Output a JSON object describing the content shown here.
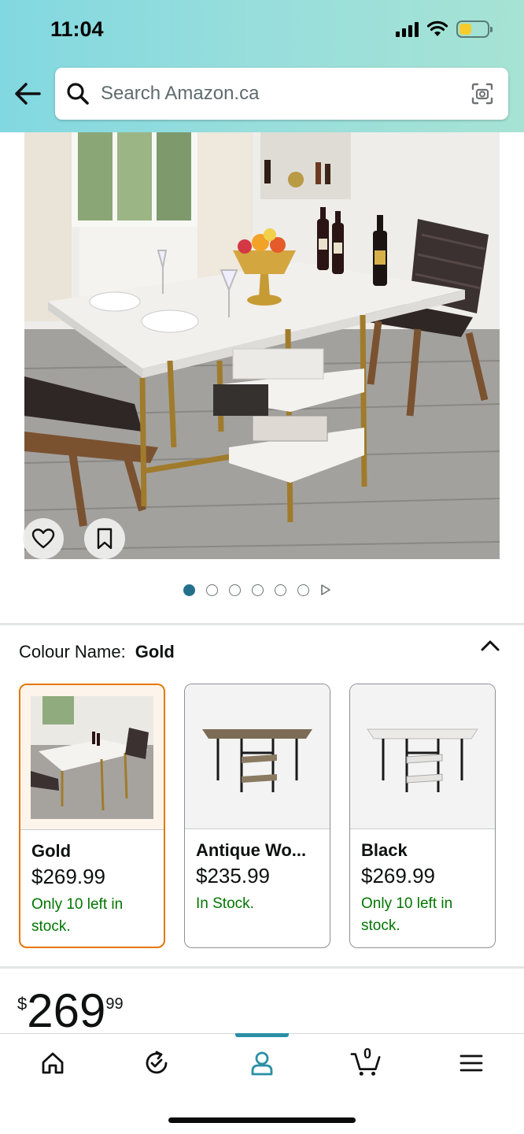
{
  "status_bar": {
    "time": "11:04"
  },
  "search": {
    "placeholder": "Search Amazon.ca"
  },
  "carousel": {
    "total_dots": 6,
    "active_index": 0
  },
  "colour": {
    "label": "Colour Name:",
    "value": "Gold"
  },
  "swatches": [
    {
      "name": "Gold",
      "price": "$269.99",
      "stock": "Only 10 left in stock.",
      "selected": true
    },
    {
      "name": "Antique Wo...",
      "price": "$235.99",
      "stock": "In Stock.",
      "selected": false
    },
    {
      "name": "Black",
      "price": "$269.99",
      "stock": "Only 10 left in stock.",
      "selected": false
    }
  ],
  "price": {
    "symbol": "$",
    "whole": "269",
    "fraction": "99"
  },
  "cart": {
    "count": "0"
  },
  "colors": {
    "accent": "#23708c",
    "selected_border": "#e77600",
    "stock_green": "#007600"
  },
  "icons": [
    "back-arrow-icon",
    "search-icon",
    "camera-icon",
    "heart-icon",
    "bookmark-icon",
    "chevron-up-icon",
    "home-icon",
    "refresh-icon",
    "account-icon",
    "cart-icon",
    "menu-icon"
  ]
}
